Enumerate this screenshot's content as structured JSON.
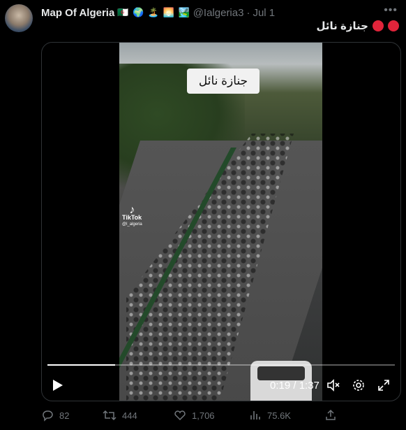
{
  "author": {
    "name": "Map Of Algeria",
    "emojis": "🇩🇿 🌍 🏝️ 🌅 🏞️",
    "handle": "@Ialgeria3",
    "separator": "·",
    "date": "Jul 1"
  },
  "tweet": {
    "text": "جنازة نائل"
  },
  "video": {
    "caption": "جنازة نائل",
    "watermark": "TikTok",
    "watermark_user": "@l_algeria",
    "time_current": "0:19",
    "time_total": "1:37",
    "time_label": "0:19 / 1:37",
    "progress": 0.195
  },
  "actions": {
    "replies": "82",
    "retweets": "444",
    "likes": "1,706",
    "views": "75.6K"
  },
  "colors": {
    "background": "#000000",
    "text": "#e7e9ea",
    "muted": "#71767b",
    "border": "#2f3336",
    "red_circle": "#e0243a"
  },
  "icons": [
    "more-icon",
    "play-icon",
    "mute-icon",
    "settings-icon",
    "fullscreen-icon",
    "reply-icon",
    "retweet-icon",
    "like-icon",
    "views-icon",
    "share-icon"
  ]
}
